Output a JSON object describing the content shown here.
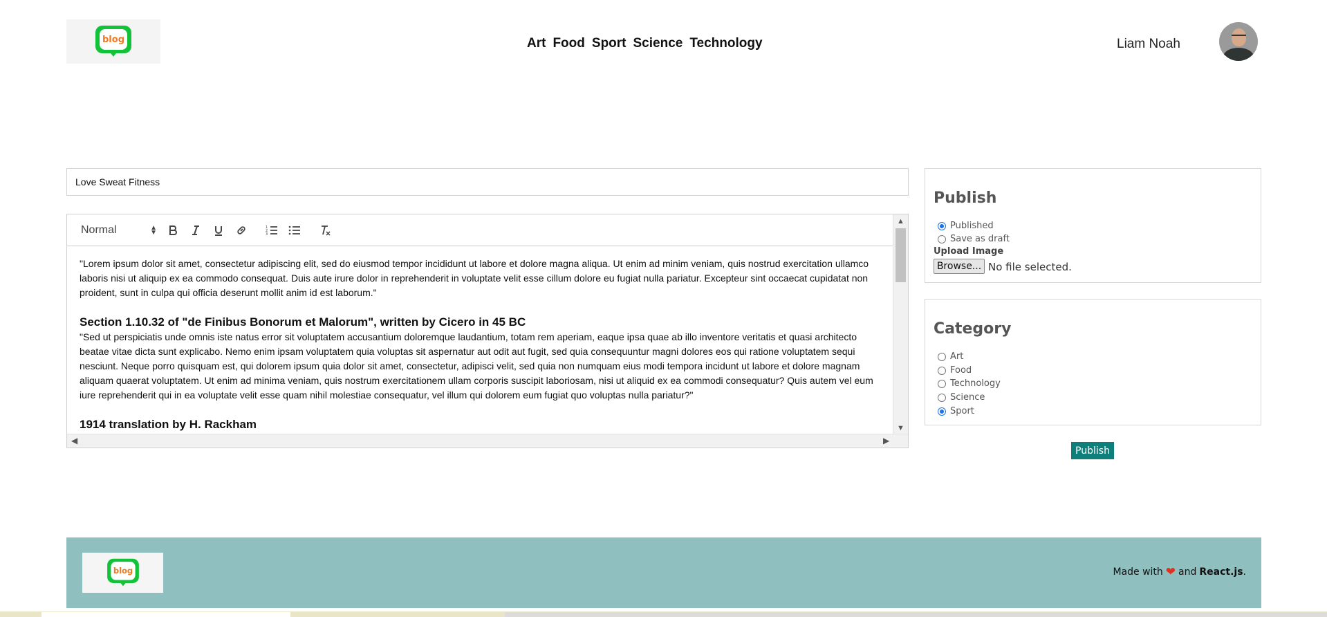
{
  "header": {
    "logo_text": "blog",
    "nav": [
      "Art",
      "Food",
      "Sport",
      "Science",
      "Technology"
    ],
    "user_name": "Liam Noah"
  },
  "editor": {
    "title_value": "Love Sweat Fitness",
    "format_select": "Normal",
    "content": {
      "p1": "\"Lorem ipsum dolor sit amet, consectetur adipiscing elit, sed do eiusmod tempor incididunt ut labore et dolore magna aliqua. Ut enim ad minim veniam, quis nostrud exercitation ullamco laboris nisi ut aliquip ex ea commodo consequat. Duis aute irure dolor in reprehenderit in voluptate velit esse cillum dolore eu fugiat nulla pariatur. Excepteur sint occaecat cupidatat non proident, sunt in culpa qui officia deserunt mollit anim id est laborum.\"",
      "h1": "Section 1.10.32 of \"de Finibus Bonorum et Malorum\", written by Cicero in 45 BC",
      "p2": "\"Sed ut perspiciatis unde omnis iste natus error sit voluptatem accusantium doloremque laudantium, totam rem aperiam, eaque ipsa quae ab illo inventore veritatis et quasi architecto beatae vitae dicta sunt explicabo. Nemo enim ipsam voluptatem quia voluptas sit aspernatur aut odit aut fugit, sed quia consequuntur magni dolores eos qui ratione voluptatem sequi nesciunt. Neque porro quisquam est, qui dolorem ipsum quia dolor sit amet, consectetur, adipisci velit, sed quia non numquam eius modi tempora incidunt ut labore et dolore magnam aliquam quaerat voluptatem. Ut enim ad minima veniam, quis nostrum exercitationem ullam corporis suscipit laboriosam, nisi ut aliquid ex ea commodi consequatur? Quis autem vel eum iure reprehenderit qui in ea voluptate velit esse quam nihil molestiae consequatur, vel illum qui dolorem eum fugiat quo voluptas nulla pariatur?\"",
      "h2": "1914 translation by H. Rackham"
    }
  },
  "publish_panel": {
    "title": "Publish",
    "options": [
      "Published",
      "Save as draft"
    ],
    "selected": "Published",
    "upload_label": "Upload Image",
    "browse_label": "Browse...",
    "file_status": "No file selected."
  },
  "category_panel": {
    "title": "Category",
    "options": [
      "Art",
      "Food",
      "Technology",
      "Science",
      "Sport"
    ],
    "selected": "Sport"
  },
  "publish_button": "Publish",
  "footer": {
    "logo_text": "blog",
    "made_with": "Made with",
    "and": "and",
    "framework": "React.js",
    "period": "."
  },
  "colors": {
    "logo_green": "#12c33a",
    "logo_text": "#f07a22",
    "publish_button_bg": "#0e7f7a",
    "footer_bg": "#8fbfbe",
    "radio_selected": "#1a73e8",
    "heart": "#e0301e"
  }
}
